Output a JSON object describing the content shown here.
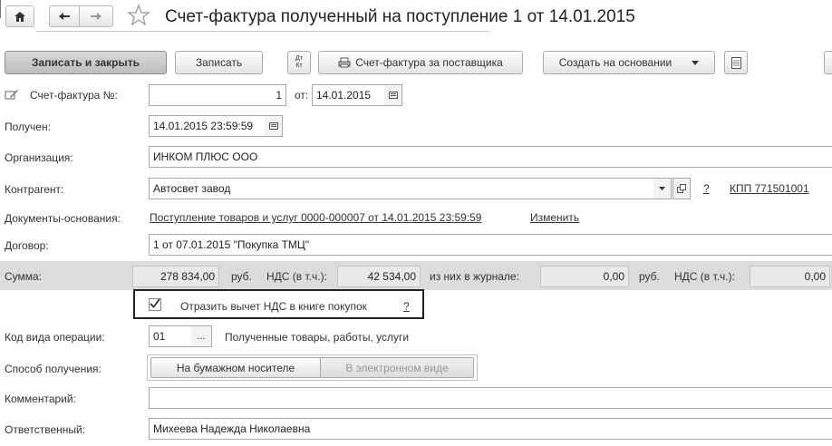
{
  "window": {
    "title": "Счет-фактура полученный на поступление 1 от 14.01.2015"
  },
  "toolbar": {
    "save_close": "Записать и закрыть",
    "save": "Записать",
    "dtkt": "Дт Кт",
    "print_invoice": "Счет-фактура за поставщика",
    "create_based": "Создать на основании"
  },
  "form": {
    "invoice_no_label": "Счет-фактура №:",
    "invoice_no": "1",
    "from_label": "от:",
    "invoice_date": "14.01.2015",
    "received_label": "Получен:",
    "received_value": "14.01.2015 23:59:59",
    "org_label": "Организация:",
    "org_value": "ИНКОМ ПЛЮС ООО",
    "contractor_label": "Контрагент:",
    "contractor_value": "Автосвет завод",
    "contractor_help": "?",
    "kpp_link": "КПП 771501001",
    "docs_label": "Документы-основания:",
    "docs_link": "Поступление товаров и услуг 0000-000007 от 14.01.2015 23:59:59",
    "docs_change": "Изменить",
    "contract_label": "Договор:",
    "contract_value": "1 от 07.01.2015 \"Покупка ТМЦ\"",
    "sum_label": "Сумма:",
    "sum_value": "278 834,00",
    "currency1": "руб.",
    "vat_label": "НДС (в т.ч.):",
    "vat_value": "42 534,00",
    "journal_label": "из них в журнале:",
    "journal_value": "0,00",
    "currency2": "руб.",
    "vat2_label": "НДС (в т.ч.):",
    "vat2_value": "0,00",
    "reflect_label": "Отразить вычет НДС в книге покупок",
    "reflect_help": "?",
    "reflect_checked": true,
    "op_code_label": "Код вида операции:",
    "op_code_value": "01",
    "op_code_picker": "...",
    "op_code_desc": "Полученные товары, работы, услуги",
    "method_label": "Способ получения:",
    "method_paper": "На бумажном носителе",
    "method_electronic": "В электронном виде",
    "comment_label": "Комментарий:",
    "comment_value": "",
    "responsible_label": "Ответственный:",
    "responsible_value": "Михеева Надежда Николаевна"
  },
  "colors": {
    "sum_band": "#dcdcdc",
    "primary_button": "#c8c8c8"
  },
  "icons": {
    "home": "home-icon",
    "back": "arrow-left-icon",
    "forward": "arrow-right-icon",
    "favorite": "star-icon",
    "printer": "printer-icon",
    "calendar": "calendar-icon",
    "document": "document-icon"
  }
}
